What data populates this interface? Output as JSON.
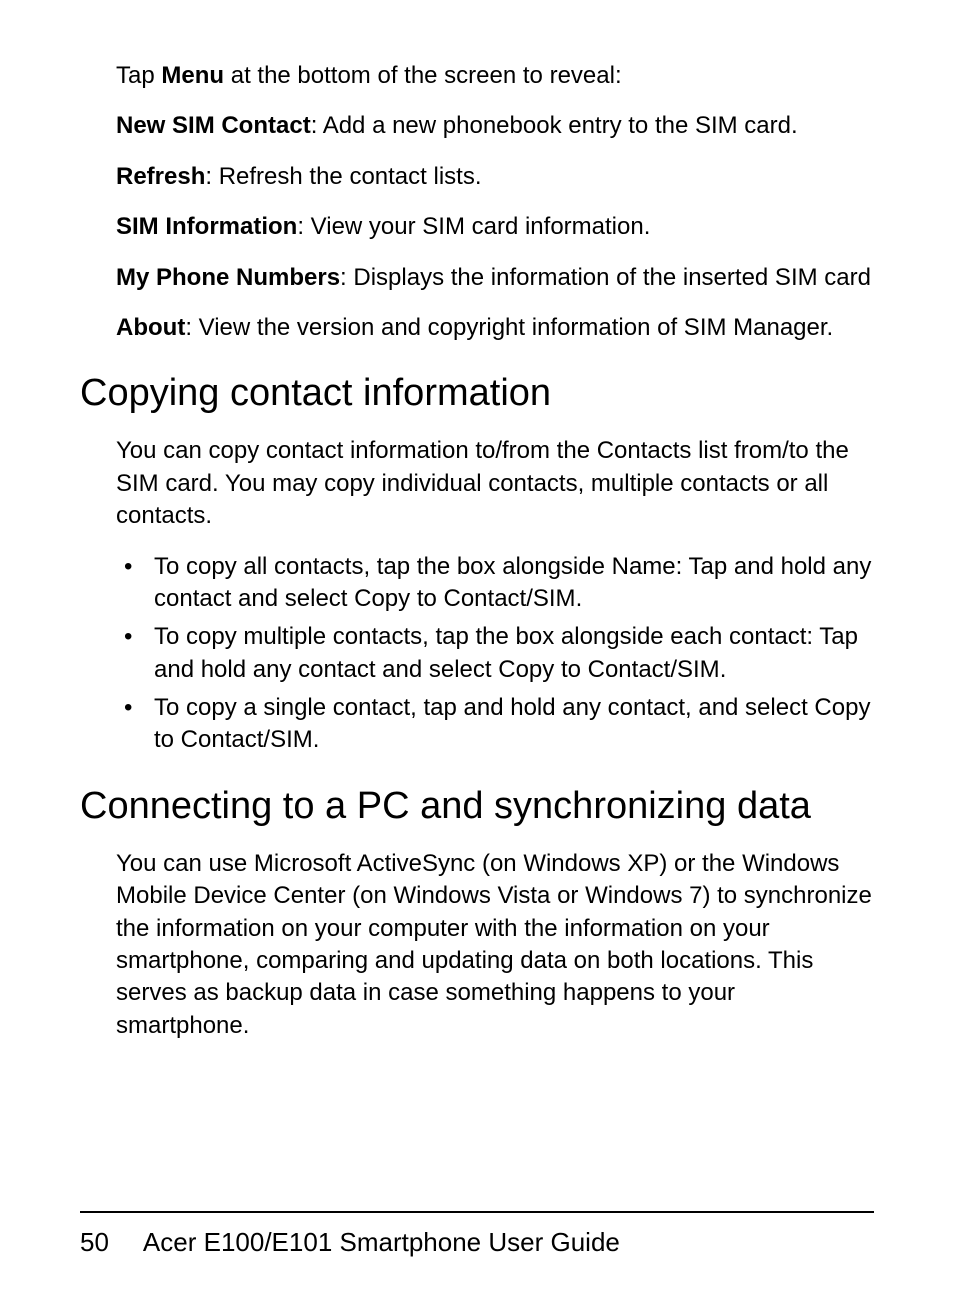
{
  "para1": {
    "pre": "Tap ",
    "bold": "Menu",
    "post": " at the bottom of the screen to reveal:"
  },
  "para2": {
    "bold": "New SIM Contact",
    "post": ": Add a new phonebook entry to the SIM card."
  },
  "para3": {
    "bold": "Refresh",
    "post": ": Refresh the contact lists."
  },
  "para4": {
    "bold": "SIM Information",
    "post": ": View your SIM card information."
  },
  "para5": {
    "bold": "My Phone Numbers",
    "post": ": Displays the information of the inserted SIM card"
  },
  "para6": {
    "bold": "About",
    "post": ": View the version and copyright information of SIM Manager."
  },
  "heading1": "Copying contact information",
  "para7": "You can copy contact information to/from the Contacts list from/to the SIM card. You may copy individual contacts, multiple contacts or all contacts.",
  "bullets": {
    "b1": {
      "pre": "To copy all contacts, tap the box alongside Name: Tap and hold any contact and select ",
      "bold": "Copy to Contact/SIM",
      "post": "."
    },
    "b2": {
      "pre": "To copy multiple contacts, tap the box alongside each contact: Tap and hold any contact and select ",
      "bold": "Copy to Contact/SIM",
      "post": "."
    },
    "b3": {
      "pre": "To copy a single contact, tap and hold any contact, and select ",
      "bold": "Copy to Contact/SIM",
      "post": "."
    }
  },
  "heading2": "Connecting to a PC and synchronizing data",
  "para8": "You can use Microsoft ActiveSync (on Windows XP) or the Windows Mobile Device Center (on Windows Vista or Windows 7) to synchronize the information on your computer with the information on your smartphone, comparing and updating data on both locations. This serves as backup data in case something happens to your smartphone.",
  "footer": {
    "pageNum": "50",
    "title": "Acer E100/E101 Smartphone User Guide"
  }
}
